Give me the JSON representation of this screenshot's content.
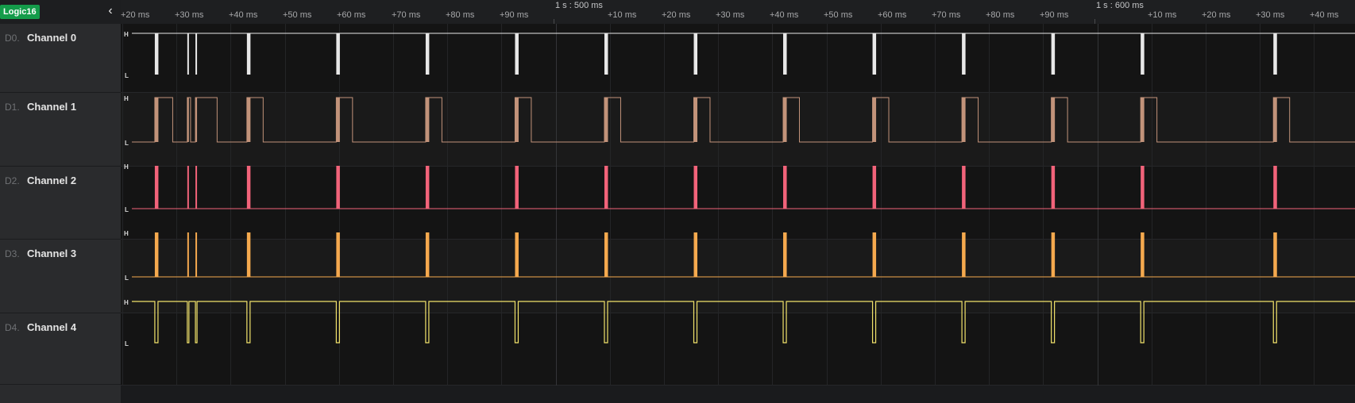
{
  "device": {
    "name": "Logic16"
  },
  "sidebar": {
    "collapse_icon": "chevron-left-icon",
    "channels": [
      {
        "index": "D0.",
        "name": "Channel 0"
      },
      {
        "index": "D1.",
        "name": "Channel 1"
      },
      {
        "index": "D2.",
        "name": "Channel 2"
      },
      {
        "index": "D3.",
        "name": "Channel 3"
      },
      {
        "index": "D4.",
        "name": "Channel 4"
      }
    ]
  },
  "timeline": {
    "ticks": [
      "+20 ms",
      "+30 ms",
      "+40 ms",
      "+50 ms",
      "+60 ms",
      "+70 ms",
      "+80 ms",
      "+90 ms",
      "+10 ms",
      "+20 ms",
      "+30 ms",
      "+40 ms",
      "+50 ms",
      "+60 ms",
      "+70 ms",
      "+80 ms",
      "+90 ms",
      "+10 ms",
      "+20 ms",
      "+30 ms",
      "+40 ms"
    ],
    "major_labels": [
      "1 s : 500 ms",
      "1 s : 600 ms"
    ],
    "level_high": "H",
    "level_low": "L"
  },
  "waveforms": {
    "pulse_times_ms": [
      426,
      432,
      433.5,
      443,
      459.5,
      476,
      492.5,
      509,
      525.5,
      542,
      558.5,
      575,
      591.5,
      608,
      632.5
    ],
    "colors": {
      "Channel 0": "#e8e8e8",
      "Channel 1": "#c2937a",
      "Channel 2": "#f2637a",
      "Channel 3": "#f5a94e",
      "Channel 4": "#f2e36b"
    },
    "channel_styles": {
      "Channel 0": "positive-pulse-bars",
      "Channel 1": "square-wave-with-bars",
      "Channel 2": "positive-pulse-bars",
      "Channel 3": "positive-pulse-bars",
      "Channel 4": "negative-pulse-outline"
    }
  }
}
